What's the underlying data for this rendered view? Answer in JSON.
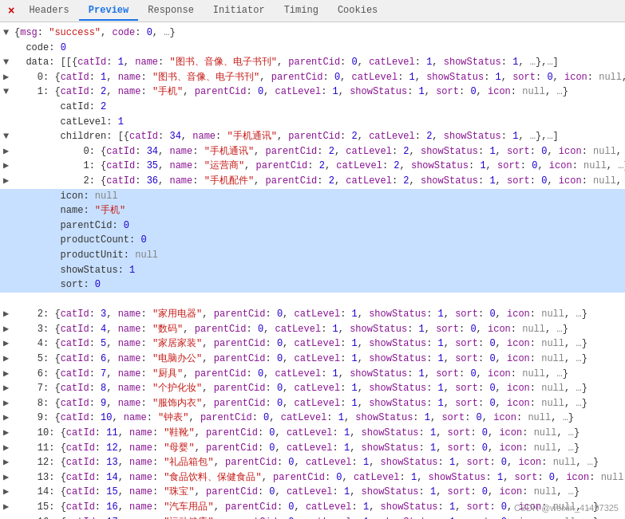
{
  "tabs": {
    "close_icon": "×",
    "items": [
      {
        "label": "Headers",
        "active": false
      },
      {
        "label": "Preview",
        "active": true
      },
      {
        "label": "Response",
        "active": false
      },
      {
        "label": "Initiator",
        "active": false
      },
      {
        "label": "Timing",
        "active": false
      },
      {
        "label": "Cookies",
        "active": false
      }
    ]
  },
  "watermark": "CSDN @weixin_41497325"
}
